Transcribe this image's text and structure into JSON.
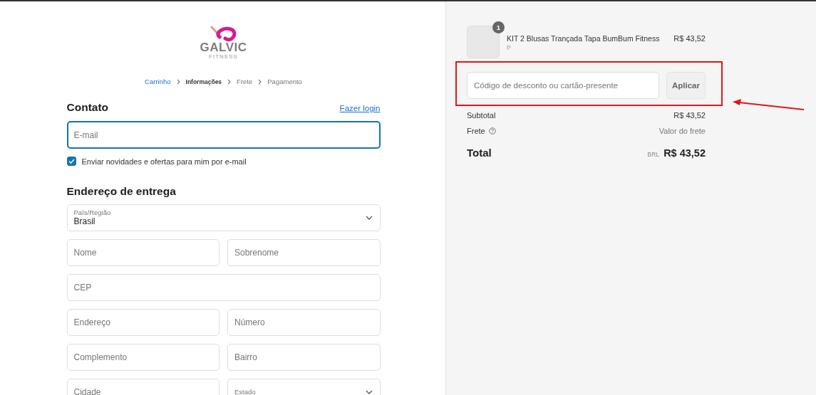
{
  "logo": {
    "name": "GALVIC",
    "tagline": "FITNESS"
  },
  "breadcrumb": [
    {
      "label": "Carrinho",
      "completed": true,
      "selected": false
    },
    {
      "label": "Informações",
      "completed": false,
      "selected": true
    },
    {
      "label": "Frete",
      "completed": false,
      "selected": false
    },
    {
      "label": "Pagamento",
      "completed": false,
      "selected": false
    }
  ],
  "contact": {
    "title": "Contato",
    "login_link": "Fazer login",
    "email": {
      "placeholder": "E-mail",
      "focused": true
    },
    "newsletter": {
      "label": "Enviar novidades e ofertas para mim por e-mail",
      "checked": true
    }
  },
  "delivery": {
    "title": "Endereço de entrega",
    "rows": [
      [
        {
          "kind": "select",
          "label": "País/Região",
          "value": "Brasil"
        }
      ],
      [
        {
          "kind": "text",
          "placeholder": "Nome"
        },
        {
          "kind": "text",
          "placeholder": "Sobrenome"
        }
      ],
      [
        {
          "kind": "text",
          "placeholder": "CEP"
        }
      ],
      [
        {
          "kind": "text",
          "placeholder": "Endereço"
        },
        {
          "kind": "text",
          "placeholder": "Número"
        }
      ],
      [
        {
          "kind": "text",
          "placeholder": "Complemento"
        },
        {
          "kind": "text",
          "placeholder": "Bairro"
        }
      ],
      [
        {
          "kind": "text",
          "placeholder": "Cidade"
        },
        {
          "kind": "select",
          "label": "Estado"
        }
      ]
    ]
  },
  "summary": {
    "items": [
      {
        "quantity": "1",
        "name": "KIT 2 Blusas Trançada Tapa BumBum Fitness",
        "variant": "P",
        "price": "R$ 43,52"
      }
    ],
    "discount": {
      "placeholder": "Código de desconto ou cartão-presente",
      "button": "Aplicar"
    },
    "subtotal": {
      "label": "Subtotal",
      "value": "R$ 43,52"
    },
    "shipping": {
      "label": "Frete",
      "value": "Valor do frete"
    },
    "total": {
      "label": "Total",
      "currency": "BRL",
      "value": "R$ 43,52"
    }
  }
}
